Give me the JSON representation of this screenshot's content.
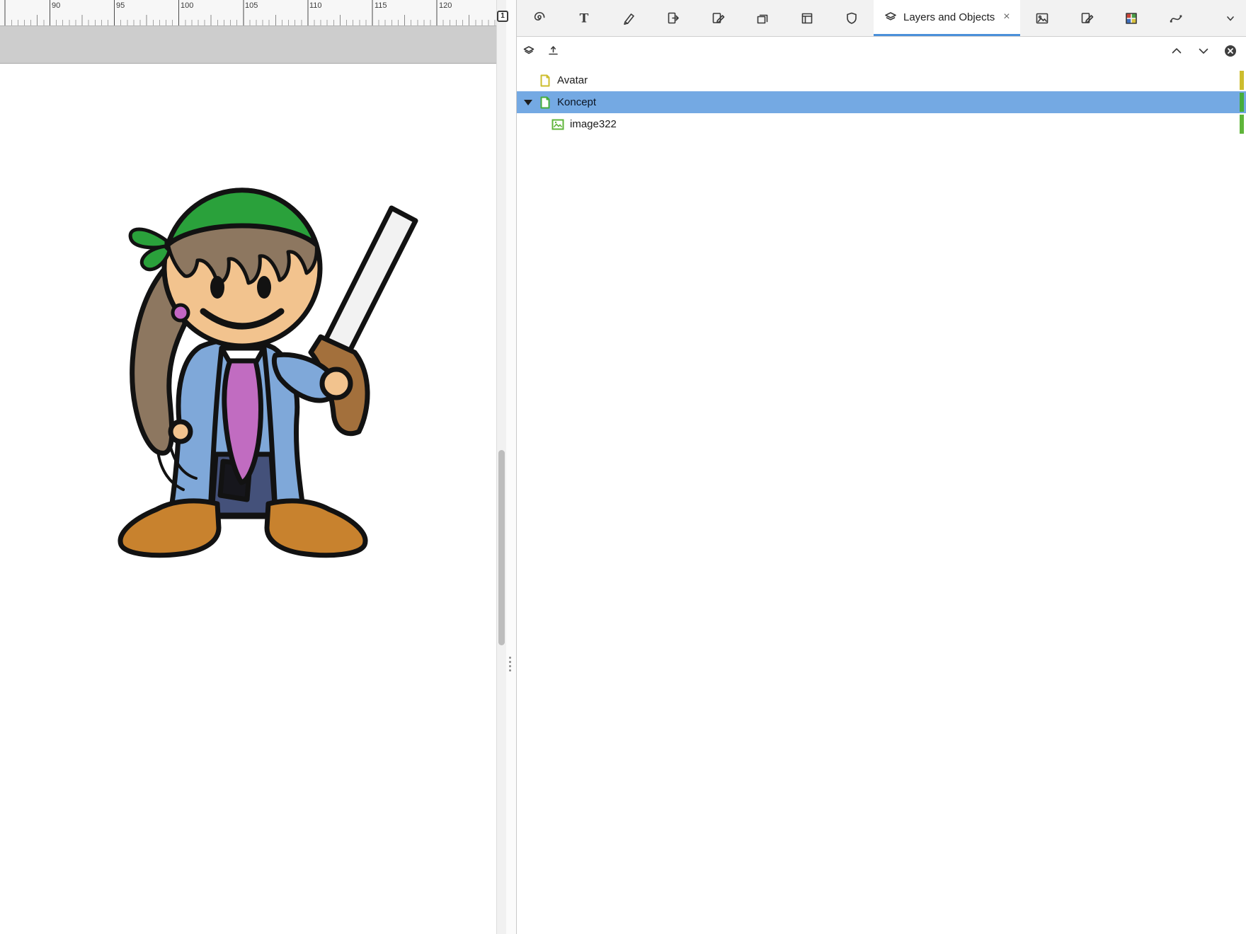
{
  "app": {
    "accent_color": "#4a90d9",
    "selection_color": "#74a9e3"
  },
  "canvas": {
    "ruler_labels": [
      "90",
      "95",
      "100",
      "105",
      "110",
      "115",
      "120"
    ],
    "page_badge": "1"
  },
  "panel": {
    "tab": {
      "label": "Layers and Objects",
      "close_glyph": "×"
    },
    "rows": [
      {
        "label": "Avatar",
        "type": "layer",
        "color": "#cdbd2e",
        "selected": false
      },
      {
        "label": "Koncept",
        "type": "layer",
        "color": "#46ad3c",
        "selected": true
      },
      {
        "label": "image322",
        "type": "object",
        "color": "#5fb53a",
        "selected": false
      }
    ]
  },
  "icons": {
    "text_glyph": "T"
  },
  "art": {
    "subject": "cartoon pirate girl with musket",
    "colors": {
      "outline": "#121212",
      "skin": "#f2c38e",
      "hair": "#8d7760",
      "bandana": "#2aa13b",
      "coat": "#7fa8d9",
      "shirt": "#ffffff",
      "tie": "#c16cc1",
      "shorts": "#44517a",
      "patch": "#16161c",
      "boots": "#c8822e",
      "barrel": "#f2f2f2",
      "stock": "#a3703c",
      "bead": "#c466c4"
    }
  }
}
